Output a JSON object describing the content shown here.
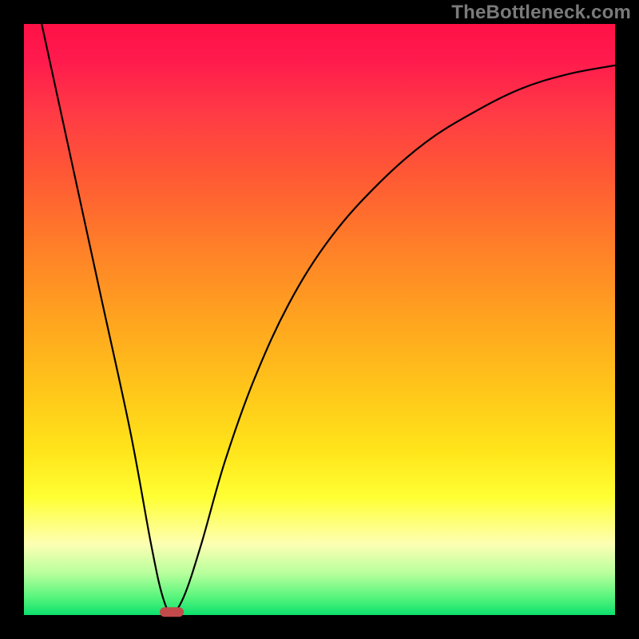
{
  "watermark": "TheBottleneck.com",
  "chart_data": {
    "type": "line",
    "title": "",
    "xlabel": "",
    "ylabel": "",
    "xlim": [
      0,
      1
    ],
    "ylim": [
      0,
      1
    ],
    "background_gradient": {
      "direction": "vertical",
      "stops": [
        {
          "pos": 0.0,
          "color": "#ff1146"
        },
        {
          "pos": 0.06,
          "color": "#ff1a4d"
        },
        {
          "pos": 0.15,
          "color": "#ff3a45"
        },
        {
          "pos": 0.26,
          "color": "#ff5a34"
        },
        {
          "pos": 0.38,
          "color": "#ff8028"
        },
        {
          "pos": 0.5,
          "color": "#ffa41f"
        },
        {
          "pos": 0.62,
          "color": "#ffc61a"
        },
        {
          "pos": 0.72,
          "color": "#ffe41a"
        },
        {
          "pos": 0.8,
          "color": "#ffff33"
        },
        {
          "pos": 0.88,
          "color": "#fdffb3"
        },
        {
          "pos": 0.93,
          "color": "#b6ff9c"
        },
        {
          "pos": 0.97,
          "color": "#56f57c"
        },
        {
          "pos": 1.0,
          "color": "#0de06e"
        }
      ]
    },
    "series": [
      {
        "name": "bottleneck-curve",
        "color": "#000000",
        "x": [
          0.03,
          0.08,
          0.13,
          0.18,
          0.215,
          0.235,
          0.25,
          0.27,
          0.3,
          0.34,
          0.39,
          0.45,
          0.52,
          0.6,
          0.68,
          0.76,
          0.84,
          0.92,
          1.0
        ],
        "y": [
          1.0,
          0.77,
          0.54,
          0.31,
          0.12,
          0.03,
          0.005,
          0.03,
          0.12,
          0.26,
          0.4,
          0.53,
          0.64,
          0.73,
          0.8,
          0.85,
          0.89,
          0.915,
          0.93
        ]
      }
    ],
    "marker": {
      "x": 0.25,
      "y": 0.005,
      "color": "#c24a4a",
      "shape": "rounded-pill"
    }
  }
}
